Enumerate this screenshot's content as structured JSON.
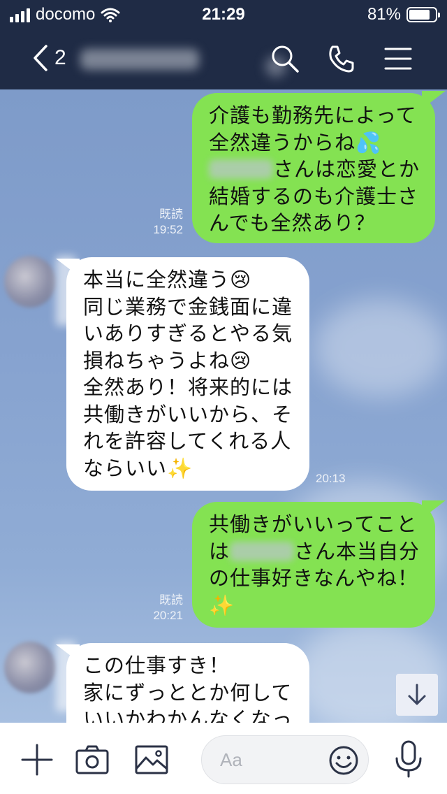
{
  "status_bar": {
    "carrier": "docomo",
    "time": "21:29",
    "battery_percent": "81%",
    "battery_level": 0.81
  },
  "header": {
    "back_label": "2",
    "icons": [
      "chevron-left-icon",
      "search-icon",
      "phone-icon",
      "menu-icon"
    ]
  },
  "messages": [
    {
      "direction": "out",
      "lines": [
        "介護も勤務先によって",
        "全然違うからね💦",
        "{name}さんは恋愛とか",
        "結婚するのも介護士さ",
        "んでも全然あり？"
      ],
      "read": "既読",
      "time": "19:52"
    },
    {
      "direction": "in",
      "lines": [
        "本当に全然違う😢",
        "同じ業務で金銭面に違",
        "いありすぎるとやる気",
        "損ねちゃうよね😢",
        "全然あり！将来的には",
        "共働きがいいから、そ",
        "れを許容してくれる人",
        "ならいい✨"
      ],
      "time": "20:13"
    },
    {
      "direction": "out",
      "lines": [
        "共働きがいいってこと",
        "は{name}さん本当自分",
        "の仕事好きなんやね！",
        "✨"
      ],
      "read": "既読",
      "time": "20:21"
    },
    {
      "direction": "in",
      "lines": [
        "この仕事すき！",
        "家にずっととか何して",
        "いいかわかんなくなっ"
      ]
    }
  ],
  "input": {
    "placeholder": "Aa",
    "value": ""
  },
  "colors": {
    "header_bg": "#1f2b45",
    "chat_bg": "#7f9ccb",
    "outgoing_bubble": "#84e252",
    "incoming_bubble": "#ffffff"
  }
}
